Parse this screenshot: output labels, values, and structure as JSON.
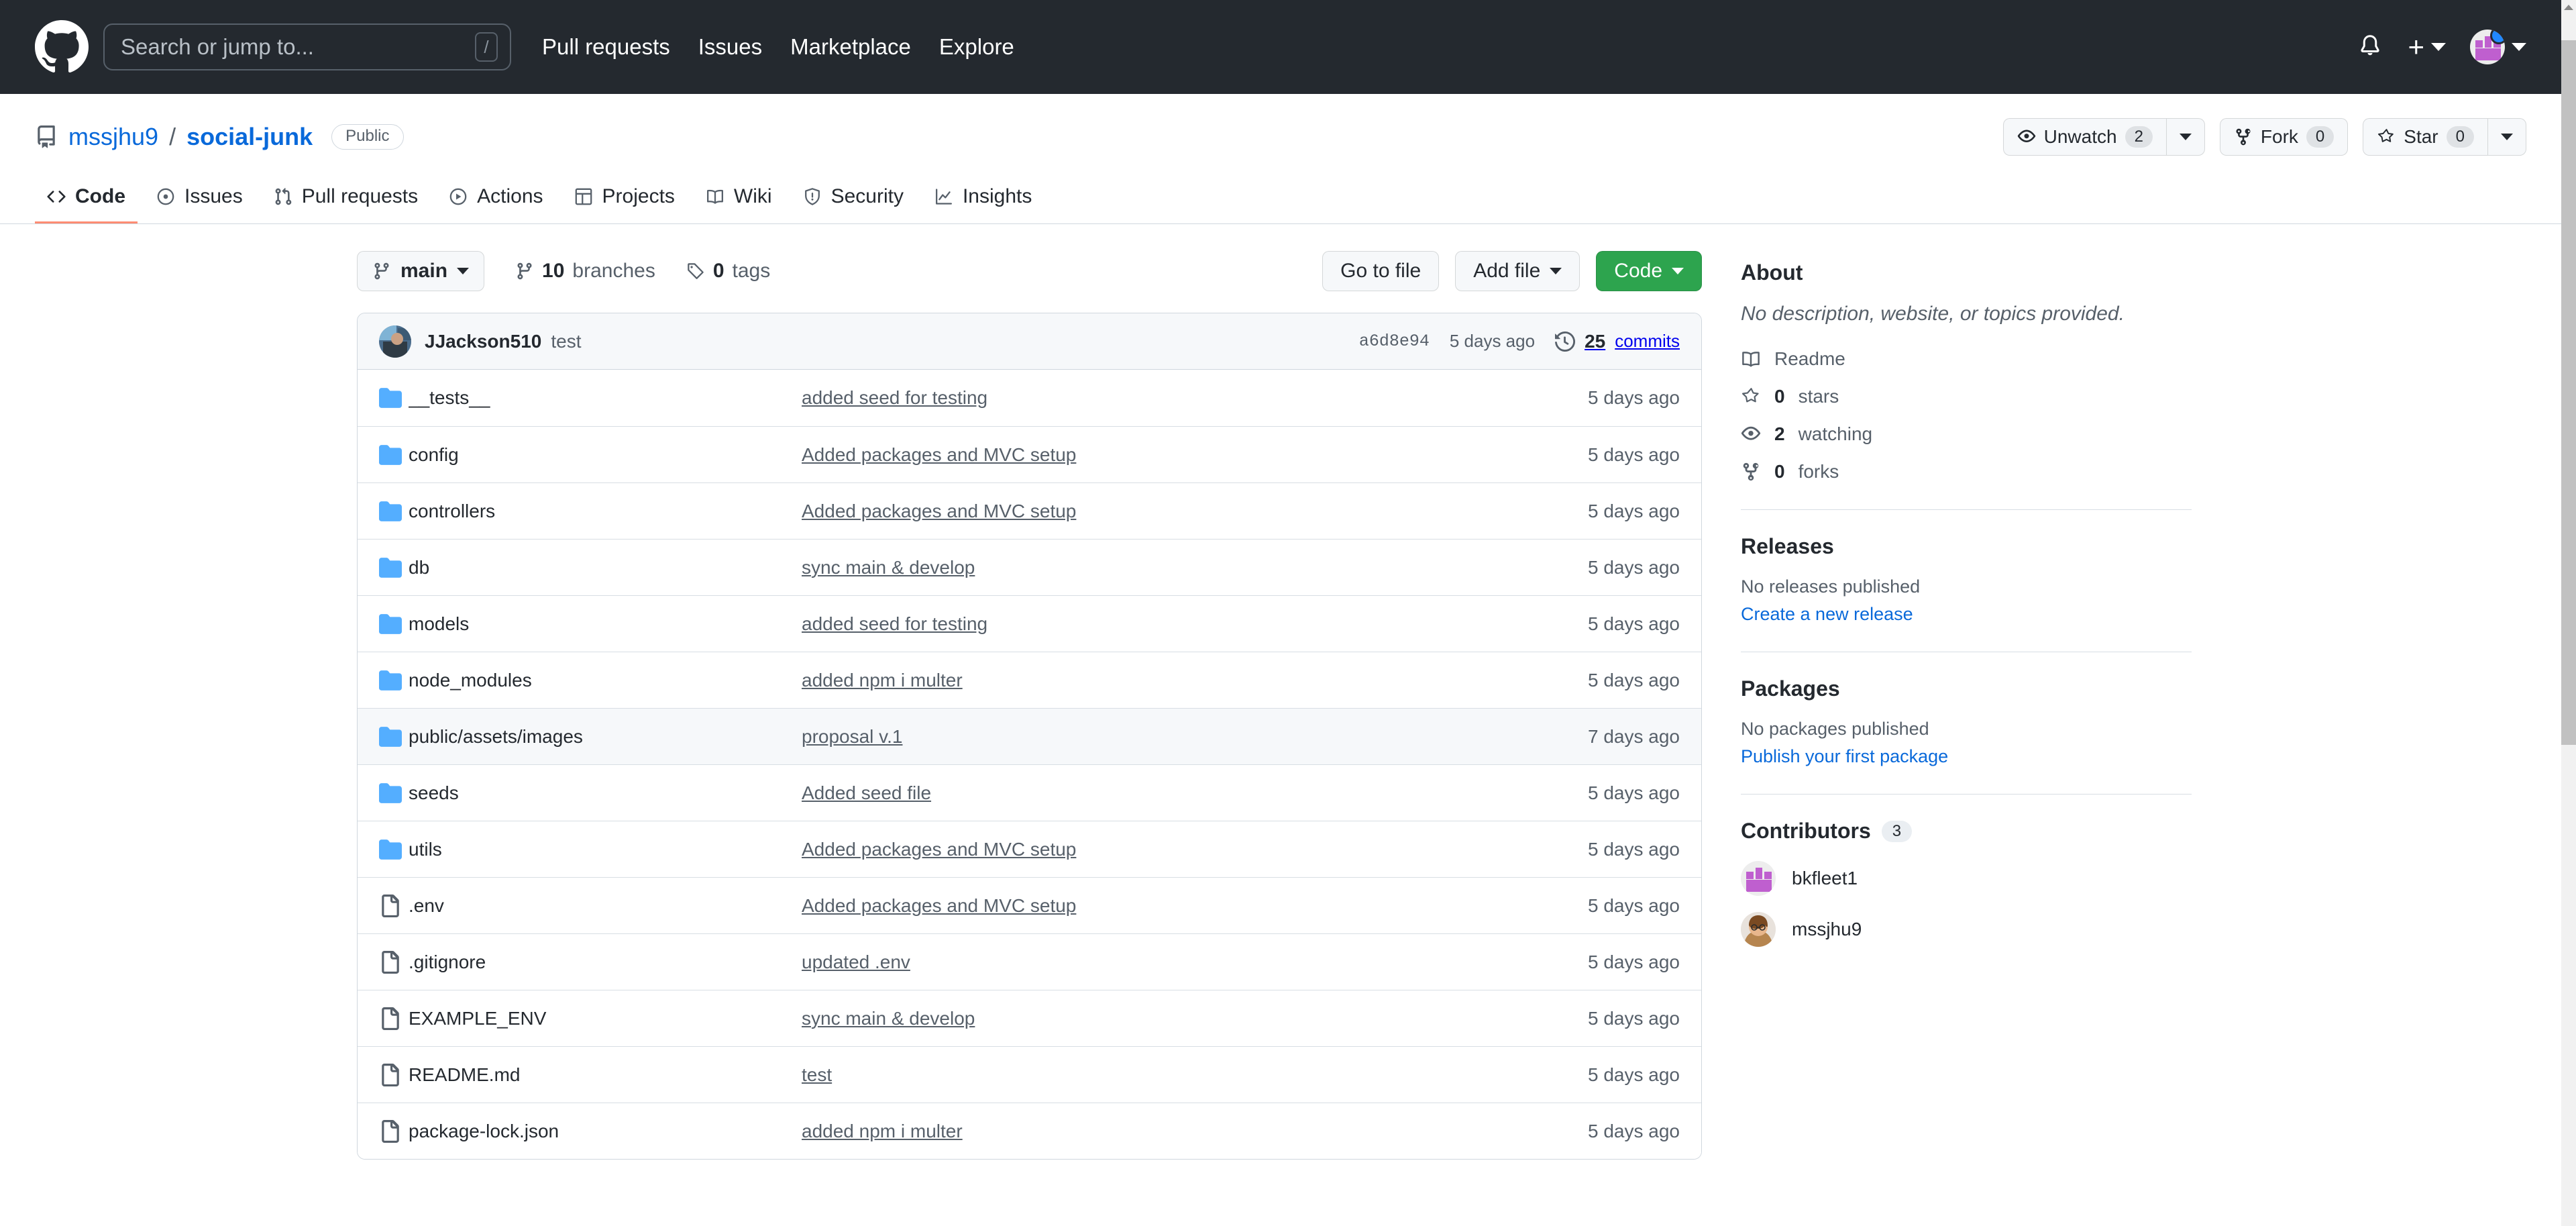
{
  "header": {
    "logo_icon": "github-mark-icon",
    "search": {
      "placeholder": "Search or jump to...",
      "value": "",
      "shortcut": "/"
    },
    "nav": [
      {
        "label": "Pull requests"
      },
      {
        "label": "Issues"
      },
      {
        "label": "Marketplace"
      },
      {
        "label": "Explore"
      }
    ],
    "notifications_icon": "bell-icon",
    "create_new_icon": "plus-icon",
    "account_icon": "avatar-icon"
  },
  "repo": {
    "icon": "repo-book-icon",
    "owner": "mssjhu9",
    "separator": "/",
    "name": "social-junk",
    "visibility": "Public",
    "actions": {
      "watch_label": "Unwatch",
      "watch_count": "2",
      "fork_label": "Fork",
      "fork_count": "0",
      "star_label": "Star",
      "star_count": "0"
    }
  },
  "tabs": [
    {
      "label": "Code",
      "icon": "code-icon",
      "active": true
    },
    {
      "label": "Issues",
      "icon": "issue-opened-icon",
      "active": false
    },
    {
      "label": "Pull requests",
      "icon": "git-pull-request-icon",
      "active": false
    },
    {
      "label": "Actions",
      "icon": "play-icon",
      "active": false
    },
    {
      "label": "Projects",
      "icon": "table-icon",
      "active": false
    },
    {
      "label": "Wiki",
      "icon": "book-icon",
      "active": false
    },
    {
      "label": "Security",
      "icon": "shield-icon",
      "active": false
    },
    {
      "label": "Insights",
      "icon": "graph-icon",
      "active": false
    }
  ],
  "toolbar": {
    "branch_name": "main",
    "branch_icon": "git-branch-icon",
    "branches_count": "10",
    "branches_label": "branches",
    "tags_count": "0",
    "tags_label": "tags",
    "tag_icon": "tag-icon",
    "go_to_file": "Go to file",
    "add_file": "Add file",
    "code_button": "Code"
  },
  "commit_bar": {
    "author": "JJackson510",
    "message": "test",
    "sha": "a6d8e94",
    "time": "5 days ago",
    "history_icon": "history-icon",
    "commits_count": "25",
    "commits_label": "commits"
  },
  "files": [
    {
      "type": "folder",
      "name": "__tests__",
      "message": "added seed for testing",
      "time": "5 days ago",
      "highlight": false
    },
    {
      "type": "folder",
      "name": "config",
      "message": "Added packages and MVC setup",
      "time": "5 days ago",
      "highlight": false
    },
    {
      "type": "folder",
      "name": "controllers",
      "message": "Added packages and MVC setup",
      "time": "5 days ago",
      "highlight": false
    },
    {
      "type": "folder",
      "name": "db",
      "message": "sync main & develop",
      "time": "5 days ago",
      "highlight": false
    },
    {
      "type": "folder",
      "name": "models",
      "message": "added seed for testing",
      "time": "5 days ago",
      "highlight": false
    },
    {
      "type": "folder",
      "name": "node_modules",
      "message": "added npm i multer",
      "time": "5 days ago",
      "highlight": false
    },
    {
      "type": "folder",
      "name": "public/assets/images",
      "message": "proposal v.1",
      "time": "7 days ago",
      "highlight": true
    },
    {
      "type": "folder",
      "name": "seeds",
      "message": "Added seed file",
      "time": "5 days ago",
      "highlight": false
    },
    {
      "type": "folder",
      "name": "utils",
      "message": "Added packages and MVC setup",
      "time": "5 days ago",
      "highlight": false
    },
    {
      "type": "file",
      "name": ".env",
      "message": "Added packages and MVC setup",
      "time": "5 days ago",
      "highlight": false
    },
    {
      "type": "file",
      "name": ".gitignore",
      "message": "updated .env",
      "time": "5 days ago",
      "highlight": false
    },
    {
      "type": "file",
      "name": "EXAMPLE_ENV",
      "message": "sync main & develop",
      "time": "5 days ago",
      "highlight": false
    },
    {
      "type": "file",
      "name": "README.md",
      "message": "test",
      "time": "5 days ago",
      "highlight": false
    },
    {
      "type": "file",
      "name": "package-lock.json",
      "message": "added npm i multer",
      "time": "5 days ago",
      "highlight": false
    }
  ],
  "about": {
    "title": "About",
    "description": "No description, website, or topics provided.",
    "links": [
      {
        "icon": "book-icon",
        "strong": "",
        "label": "Readme"
      },
      {
        "icon": "star-icon",
        "strong": "0",
        "label": "stars"
      },
      {
        "icon": "eye-icon",
        "strong": "2",
        "label": "watching"
      },
      {
        "icon": "fork-icon",
        "strong": "0",
        "label": "forks"
      }
    ]
  },
  "releases": {
    "title": "Releases",
    "note": "No releases published",
    "link": "Create a new release"
  },
  "packages": {
    "title": "Packages",
    "note": "No packages published",
    "link": "Publish your first package"
  },
  "contributors": {
    "title": "Contributors",
    "count": "3",
    "people": [
      {
        "name": "bkfleet1",
        "avatar": "identicon"
      },
      {
        "name": "mssjhu9",
        "avatar": "photo"
      }
    ]
  },
  "colors": {
    "header_bg": "#24292f",
    "accent_blue": "#0969da",
    "green_button": "#2da44e",
    "active_tab_underline": "#fd8c73",
    "folder_blue": "#54aeff"
  }
}
